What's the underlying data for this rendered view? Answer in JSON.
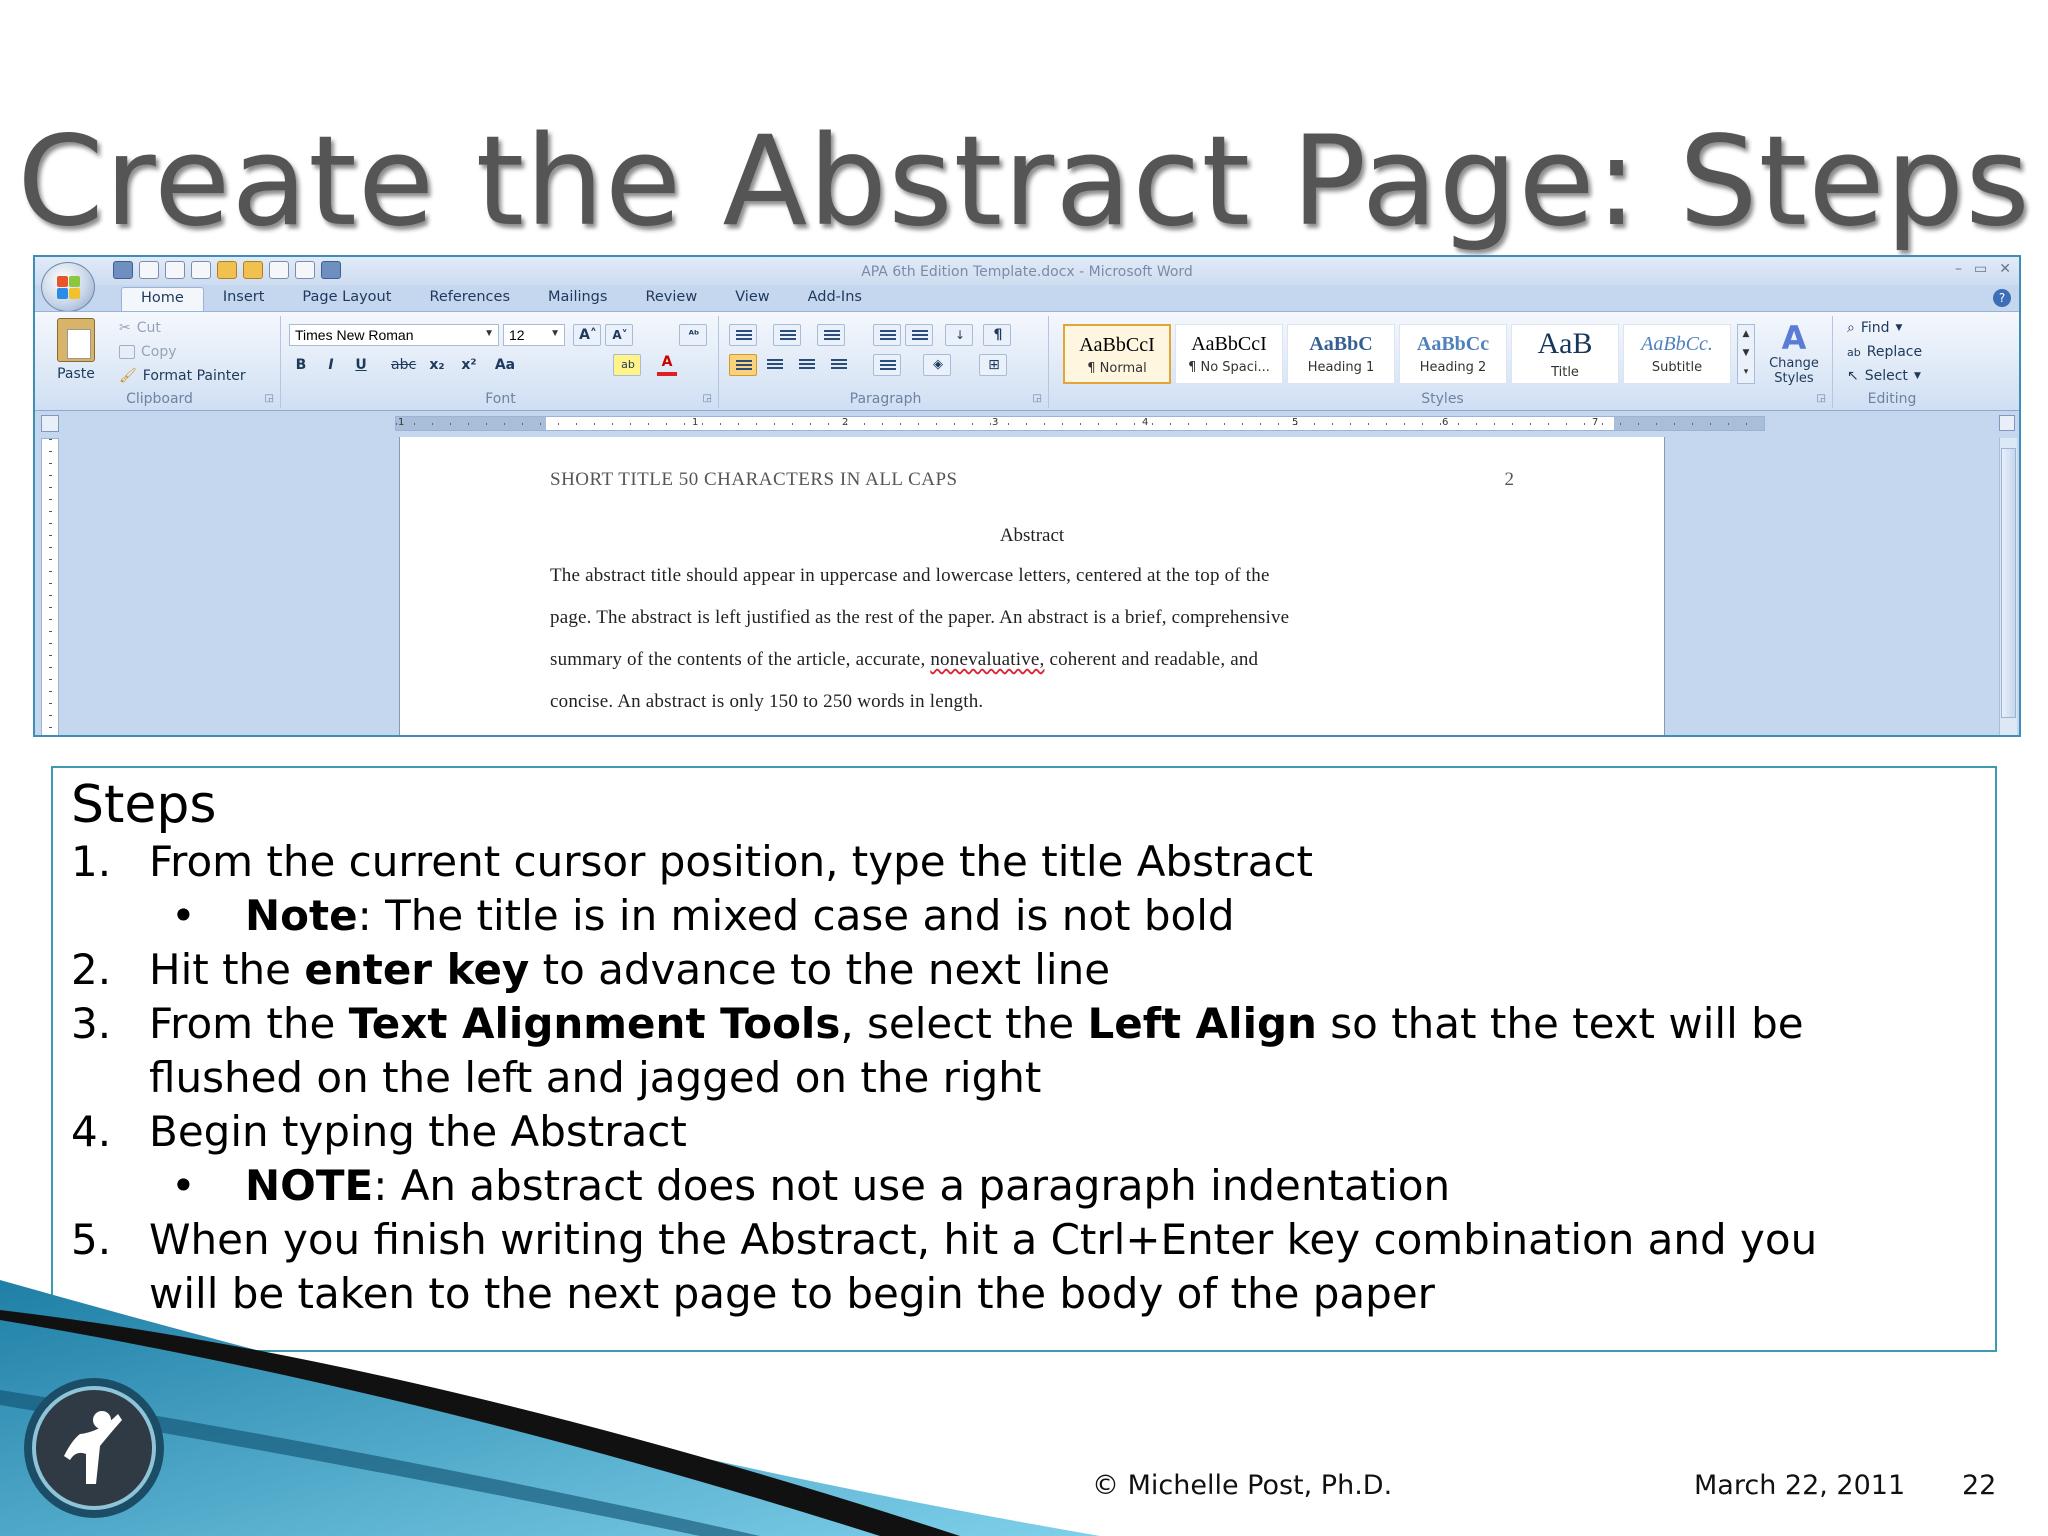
{
  "slide": {
    "title": "Create the Abstract Page: Steps",
    "footer_author": "© Michelle Post, Ph.D.",
    "footer_date": "March 22, 2011",
    "footer_page": "22"
  },
  "word": {
    "window_title": "APA 6th Edition Template.docx - Microsoft Word",
    "tabs": [
      "Home",
      "Insert",
      "Page Layout",
      "References",
      "Mailings",
      "Review",
      "View",
      "Add-Ins"
    ],
    "active_tab": "Home",
    "clipboard": {
      "paste": "Paste",
      "cut": "Cut",
      "copy": "Copy",
      "format_painter": "Format Painter",
      "label": "Clipboard"
    },
    "font": {
      "name": "Times New Roman",
      "size": "12",
      "label": "Font",
      "bold": "B",
      "italic": "I",
      "underline": "U",
      "strike": "abc",
      "subscript": "x₂",
      "superscript": "x²",
      "change_case": "Aa"
    },
    "paragraph": {
      "label": "Paragraph"
    },
    "styles": {
      "label": "Styles",
      "items": [
        {
          "sample": "AaBbCcI",
          "name": "¶ Normal"
        },
        {
          "sample": "AaBbCcI",
          "name": "¶ No Spaci..."
        },
        {
          "sample": "AaBbC",
          "name": "Heading 1"
        },
        {
          "sample": "AaBbCc",
          "name": "Heading 2"
        },
        {
          "sample": "AaB",
          "name": "Title"
        },
        {
          "sample": "AaBbCc.",
          "name": "Subtitle"
        }
      ],
      "change_styles": "Change Styles"
    },
    "editing": {
      "label": "Editing",
      "find": "Find",
      "replace": "Replace",
      "select": "Select"
    },
    "ruler_numbers": [
      "1",
      "1",
      "2",
      "3",
      "4",
      "5",
      "6",
      "7"
    ],
    "document": {
      "running_head": "SHORT TITLE 50 CHARACTERS IN ALL CAPS",
      "page_number": "2",
      "abstract_title": "Abstract",
      "lines": [
        "The abstract title should appear in uppercase and lowercase letters, centered at the top of the",
        "page. The abstract is left justified as the rest of the paper.  An abstract is a brief, comprehensive",
        "summary of the contents of the article, accurate,",
        "concise.  An abstract is only 150 to 250 words in length."
      ],
      "misspelled_word": "nonevaluative,",
      "line3_tail": "coherent and readable, and"
    }
  },
  "steps": {
    "heading": "Steps",
    "items": [
      {
        "num": "1.",
        "text": "From the current cursor position, type the title Abstract"
      },
      {
        "bullet": "•",
        "bold": "Note",
        "text": ": The title is in mixed case and is not bold"
      },
      {
        "num": "2.",
        "pre": "Hit the ",
        "bold": "enter key",
        "post": " to advance to the next line"
      },
      {
        "num": "3.",
        "pre": "From the ",
        "bold": "Text Alignment Tools",
        "mid": ", select the ",
        "bold2": "Left Align",
        "post": " so that the text will be",
        "line2": "flushed on the left and jagged on the right"
      },
      {
        "num": "4.",
        "text": "Begin typing the Abstract"
      },
      {
        "bullet": "•",
        "bold": "NOTE",
        "text": ": An abstract does not use a paragraph indentation"
      },
      {
        "num": "5.",
        "text": "When you finish writing the Abstract, hit a Ctrl+Enter key combination and you",
        "line2": "will be taken to the next page to begin the body of the paper"
      }
    ]
  },
  "colors": {
    "title_gray": "#555555",
    "steps_border": "#3d9bb0",
    "word_frame": "#3d8fb6",
    "ribbon_blue": "#c5d7ee",
    "active_style_border": "#e3a43a",
    "decor_teal": "#2a8fb5"
  }
}
